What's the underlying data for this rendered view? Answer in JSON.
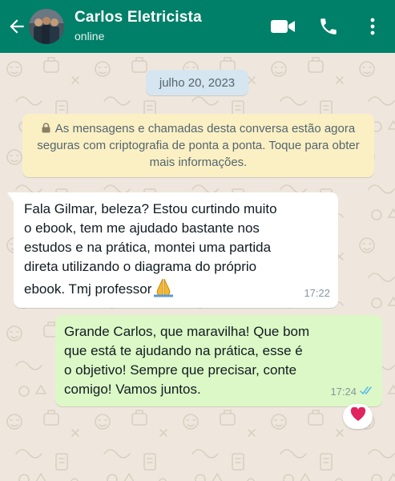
{
  "header": {
    "title": "Carlos Eletricista",
    "status": "online"
  },
  "chat": {
    "date_chip": "julho 20, 2023",
    "system_notice": "As mensagens e chamadas desta conversa estão agora seguras com criptografia de ponta a ponta. Toque para obter mais informações.",
    "messages": [
      {
        "direction": "incoming",
        "text": "Fala Gilmar, beleza? Estou curtindo muito\no ebook, tem me ajudado bastante nos\nestudos e na prática, montei uma partida\ndireta utilizando o diagrama do próprio\nebook. Tmj professor",
        "emoji": "folded-hands",
        "time": "17:22"
      },
      {
        "direction": "outgoing",
        "text": "Grande Carlos, que maravilha! Que bom\nque está te ajudando na prática, esse é\no objetivo! Sempre que precisar, conte\ncomigo! Vamos juntos.",
        "time": "17:24",
        "status": "read",
        "reaction": "heart"
      }
    ]
  },
  "colors": {
    "header_bg": "#008069",
    "chat_bg": "#efe7dd",
    "incoming_bubble": "#ffffff",
    "outgoing_bubble": "#dcf8c6",
    "system_notice_bg": "#fbf0c4",
    "date_chip_bg": "#d5e6f1",
    "read_ticks": "#53bdeb",
    "reaction_heart": "#e0245e"
  },
  "icons": [
    "back-arrow-icon",
    "video-call-icon",
    "phone-icon",
    "more-options-icon",
    "lock-icon",
    "double-check-icon",
    "heart-icon",
    "folded-hands-icon"
  ]
}
